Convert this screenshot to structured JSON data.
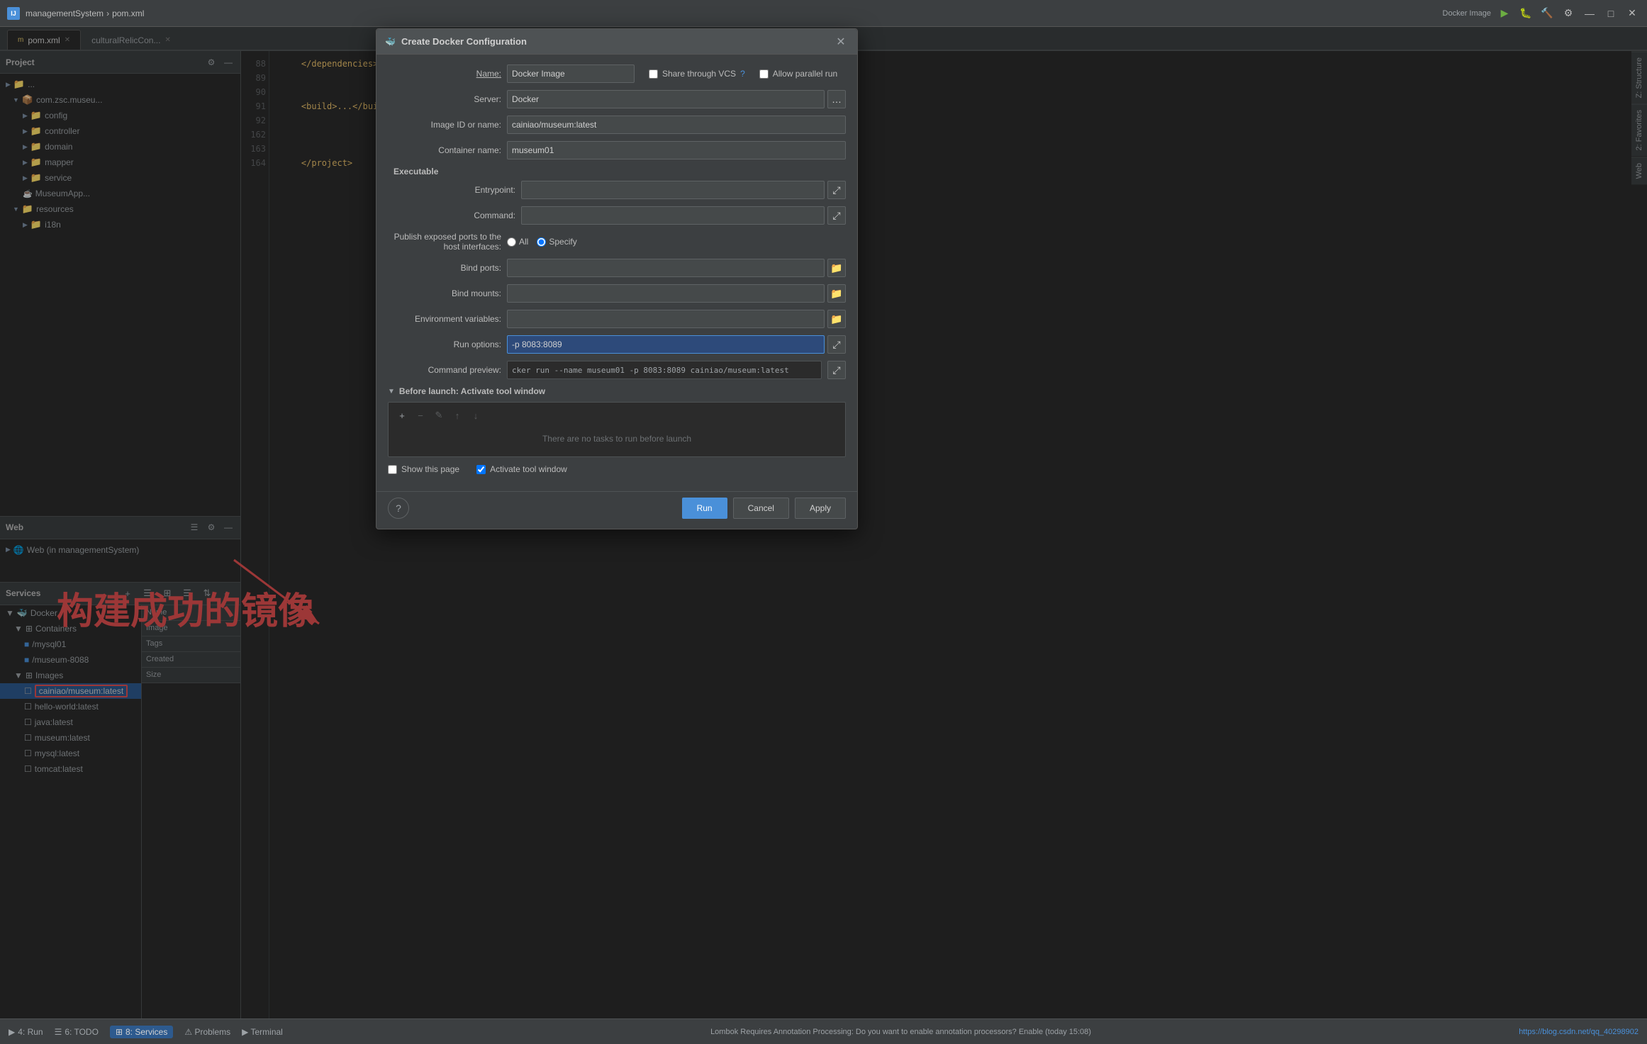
{
  "app": {
    "title": "managementSystem",
    "file": "pom.xml",
    "icon_label": "IJ"
  },
  "titlebar": {
    "breadcrumb_project": "managementSystem",
    "breadcrumb_sep": "›",
    "breadcrumb_file": "pom.xml",
    "run_config": "Docker Image",
    "run_label": "▶",
    "debug_label": "🐛",
    "build_label": "🔨"
  },
  "tabs": [
    {
      "label": "pom.xml",
      "active": true,
      "modified": false
    },
    {
      "label": "culturalRelicCon...",
      "active": false,
      "modified": false
    }
  ],
  "project_panel": {
    "title": "Project",
    "items": [
      {
        "indent": 0,
        "icon": "▶",
        "label": "...",
        "type": "folder"
      },
      {
        "indent": 1,
        "icon": "▼",
        "label": "com.zsc.museu...",
        "type": "package"
      },
      {
        "indent": 2,
        "icon": "▶",
        "label": "config",
        "type": "folder"
      },
      {
        "indent": 2,
        "icon": "▶",
        "label": "controller",
        "type": "folder"
      },
      {
        "indent": 2,
        "icon": "▶",
        "label": "domain",
        "type": "folder"
      },
      {
        "indent": 2,
        "icon": "▶",
        "label": "mapper",
        "type": "folder"
      },
      {
        "indent": 2,
        "icon": "▶",
        "label": "service",
        "type": "folder"
      },
      {
        "indent": 2,
        "icon": "📄",
        "label": "MuseumApp...",
        "type": "file"
      },
      {
        "indent": 1,
        "icon": "▼",
        "label": "resources",
        "type": "folder"
      },
      {
        "indent": 2,
        "icon": "▶",
        "label": "i18n",
        "type": "folder"
      }
    ]
  },
  "web_panel": {
    "title": "Web",
    "items": [
      {
        "label": "Web (in managementSystem)",
        "indent": 1,
        "icon": "🌐"
      }
    ]
  },
  "code_lines": [
    {
      "num": 88,
      "text": "    </dependencies>"
    },
    {
      "num": 89,
      "text": ""
    },
    {
      "num": 90,
      "text": ""
    },
    {
      "num": 91,
      "text": "    <build>...</build>"
    },
    {
      "num": 92,
      "text": ""
    },
    {
      "num": 162,
      "text": "    </project>"
    },
    {
      "num": 163,
      "text": ""
    },
    {
      "num": 164,
      "text": ""
    }
  ],
  "services_panel": {
    "title": "Services",
    "docker_label": "Docker",
    "containers_label": "Containers",
    "container_items": [
      {
        "label": "/mysql01",
        "indent": 3
      },
      {
        "label": "/museum-8088",
        "indent": 3
      }
    ],
    "images_label": "Images",
    "image_items": [
      {
        "label": "cainiao/museum:latest",
        "indent": 3,
        "selected": true,
        "highlighted": true
      },
      {
        "label": "hello-world:latest",
        "indent": 3
      },
      {
        "label": "java:latest",
        "indent": 3
      },
      {
        "label": "museum:latest",
        "indent": 3
      },
      {
        "label": "mysql:latest",
        "indent": 3
      },
      {
        "label": "tomcat:latest",
        "indent": 3
      }
    ],
    "props_columns": [
      "Name",
      "Image",
      "Tags",
      "Created",
      "Size"
    ]
  },
  "annotation": {
    "text": "构建成功的镜像"
  },
  "dialog": {
    "title": "Create Docker Configuration",
    "name_label": "Name:",
    "name_value": "Docker Image",
    "share_vcs_label": "Share through VCS",
    "allow_parallel_label": "Allow parallel run",
    "server_label": "Server:",
    "server_value": "Docker",
    "image_label": "Image ID or name:",
    "image_value": "cainiao/museum:latest",
    "container_name_label": "Container name:",
    "container_name_value": "museum01",
    "executable_label": "Executable",
    "entrypoint_label": "Entrypoint:",
    "entrypoint_value": "",
    "command_label": "Command:",
    "command_value": "",
    "publish_ports_label": "Publish exposed ports to the host interfaces:",
    "all_label": "All",
    "specify_label": "Specify",
    "bind_ports_label": "Bind ports:",
    "bind_ports_value": "",
    "bind_mounts_label": "Bind mounts:",
    "bind_mounts_value": "",
    "env_vars_label": "Environment variables:",
    "env_vars_value": "",
    "run_options_label": "Run options:",
    "run_options_value": "-p 8083:8089",
    "cmd_preview_label": "Command preview:",
    "cmd_preview_value": "cker run --name museum01 -p 8083:8089 cainiao/museum:latest",
    "before_launch_label": "Before launch: Activate tool window",
    "no_tasks_label": "There are no tasks to run before launch",
    "show_page_label": "Show this page",
    "activate_label": "Activate tool window",
    "run_btn": "Run",
    "cancel_btn": "Cancel",
    "apply_btn": "Apply"
  },
  "status_bar": {
    "run_label": "4: Run",
    "todo_label": "6: TODO",
    "services_label": "8: Services",
    "problems_label": "⚠ Problems",
    "terminal_label": "▶ Terminal",
    "message": "Lombok Requires Annotation Processing: Do you want to enable annotation processors? Enable (today 15:08)",
    "blog_text": "https://blog.csdn.net/qq_40298902"
  },
  "right_labels": [
    "Z: Structure",
    "Z: Favorites",
    "Web"
  ],
  "colors": {
    "accent_blue": "#4a90d9",
    "highlight_red": "#e05050",
    "bg_dark": "#2b2b2b",
    "bg_panel": "#3c3f41",
    "text_dim": "#9da2a6",
    "text_bright": "#d0d0d0"
  }
}
